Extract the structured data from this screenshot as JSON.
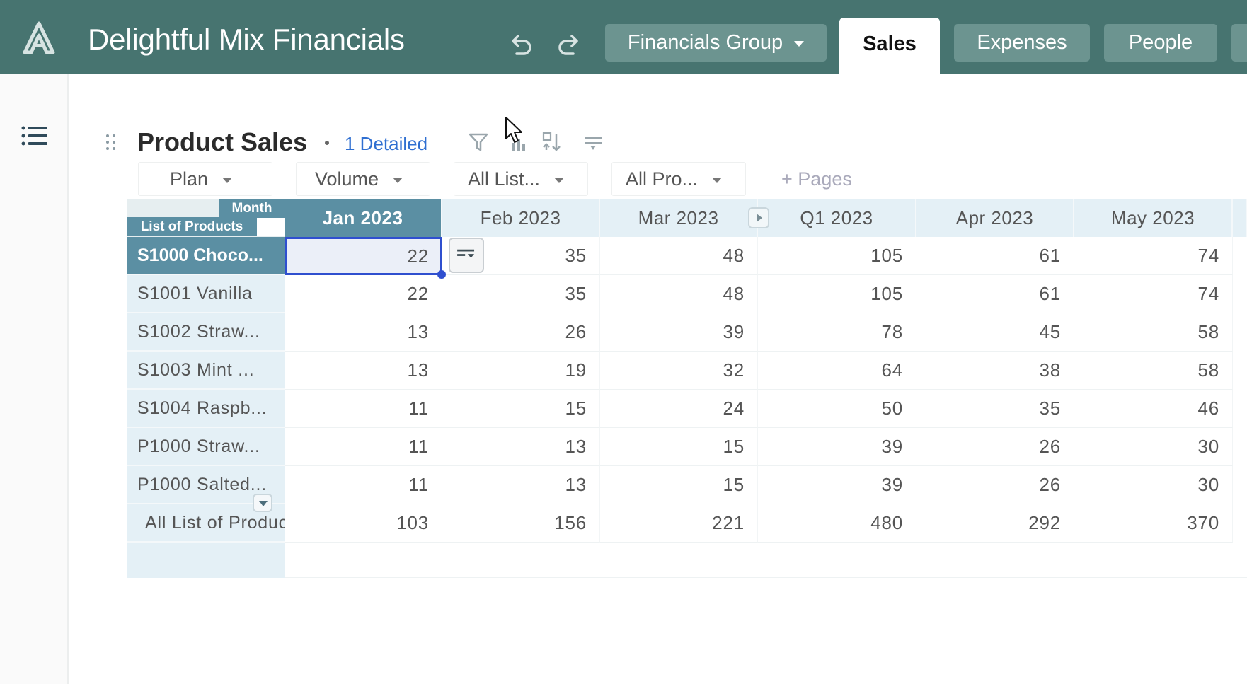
{
  "header": {
    "app_title": "Delightful Mix Financials",
    "group_label": "Financials Group",
    "active_tab": "Sales",
    "tabs": [
      "Expenses",
      "People"
    ],
    "bar_color": "#477470"
  },
  "card": {
    "title": "Product Sales",
    "detailed_link": "1 Detailed",
    "filters": [
      {
        "label": "Plan"
      },
      {
        "label": "Volume"
      },
      {
        "label": "All List..."
      },
      {
        "label": "All Pro..."
      }
    ],
    "pages_label": "Pages"
  },
  "grid": {
    "corner_column_dimension": "Month",
    "corner_row_dimension": "List of Products",
    "columns": [
      "Jan 2023",
      "Feb 2023",
      "Mar 2023",
      "Q1 2023",
      "Apr 2023",
      "May 2023"
    ],
    "rows": [
      {
        "label": "S1000 Choco...",
        "values": [
          "22",
          "35",
          "48",
          "105",
          "61",
          "74"
        ]
      },
      {
        "label": "S1001 Vanilla",
        "values": [
          "22",
          "35",
          "48",
          "105",
          "61",
          "74"
        ]
      },
      {
        "label": "S1002 Straw...",
        "values": [
          "13",
          "26",
          "39",
          "78",
          "45",
          "58"
        ]
      },
      {
        "label": "S1003 Mint ...",
        "values": [
          "13",
          "19",
          "32",
          "64",
          "38",
          "58"
        ]
      },
      {
        "label": "S1004 Raspb...",
        "values": [
          "11",
          "15",
          "24",
          "50",
          "35",
          "46"
        ]
      },
      {
        "label": "P1000 Straw...",
        "values": [
          "11",
          "13",
          "15",
          "39",
          "26",
          "30"
        ]
      },
      {
        "label": "P1000 Salted...",
        "values": [
          "11",
          "13",
          "15",
          "39",
          "26",
          "30"
        ]
      }
    ],
    "total_row": {
      "label": "All List of Produc",
      "values": [
        "103",
        "156",
        "221",
        "480",
        "292",
        "370"
      ]
    },
    "selected_cell": {
      "row": 0,
      "column": 0
    },
    "header_color": "#5b8fa3",
    "accent_color": "#2f4fcf"
  },
  "icons": {
    "logo": "app-logo-icon",
    "undo": "undo-icon",
    "redo": "redo-icon",
    "menu": "list-menu-icon",
    "drag": "drag-handle-icon",
    "toolbar": [
      "filter-icon",
      "chart-icon",
      "swap-axes-icon",
      "sort-icon"
    ],
    "pages": "plus-icon"
  }
}
